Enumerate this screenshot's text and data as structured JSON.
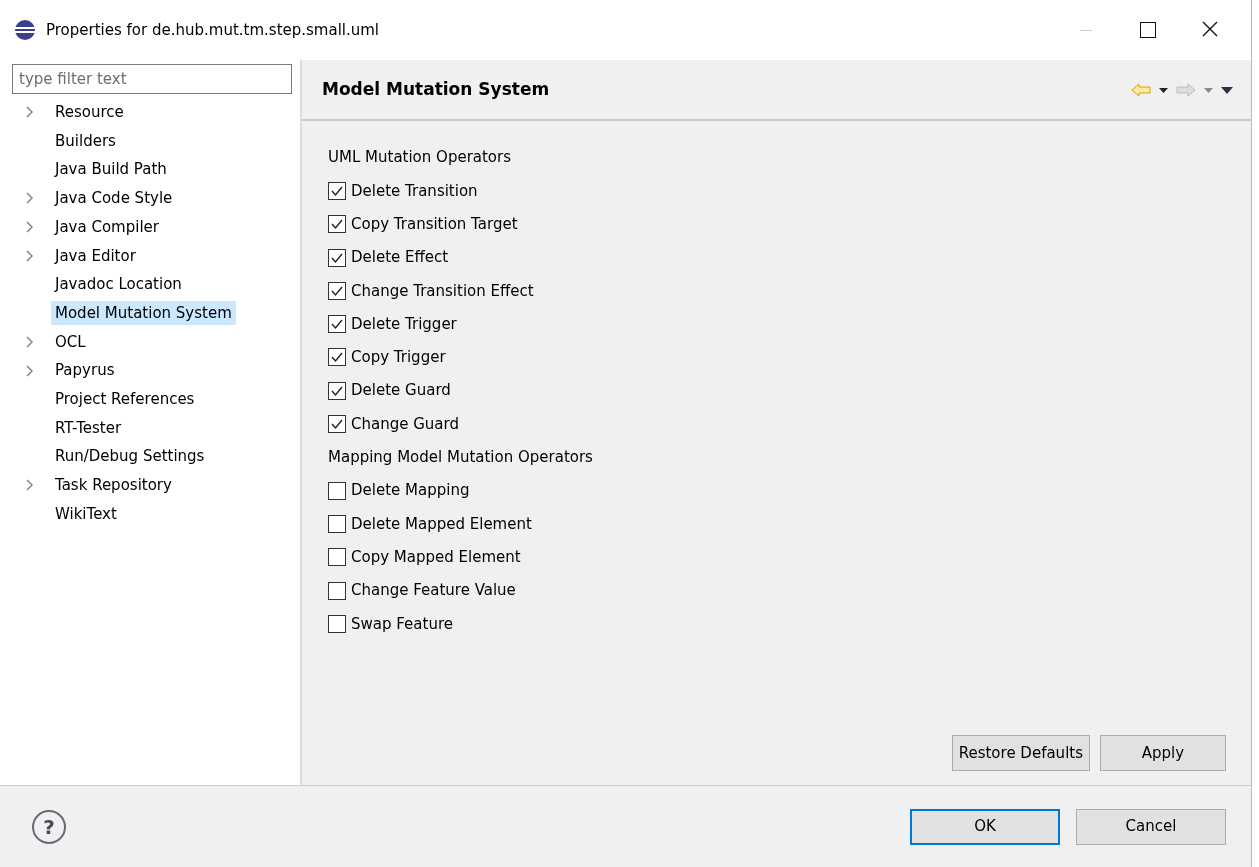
{
  "window": {
    "title": "Properties for de.hub.mut.tm.step.small.uml"
  },
  "filter": {
    "placeholder": "type filter text"
  },
  "tree": [
    {
      "label": "Resource",
      "expandable": true,
      "selected": false
    },
    {
      "label": "Builders",
      "expandable": false,
      "selected": false
    },
    {
      "label": "Java Build Path",
      "expandable": false,
      "selected": false
    },
    {
      "label": "Java Code Style",
      "expandable": true,
      "selected": false
    },
    {
      "label": "Java Compiler",
      "expandable": true,
      "selected": false
    },
    {
      "label": "Java Editor",
      "expandable": true,
      "selected": false
    },
    {
      "label": "Javadoc Location",
      "expandable": false,
      "selected": false
    },
    {
      "label": "Model Mutation System",
      "expandable": false,
      "selected": true
    },
    {
      "label": "OCL",
      "expandable": true,
      "selected": false
    },
    {
      "label": "Papyrus",
      "expandable": true,
      "selected": false
    },
    {
      "label": "Project References",
      "expandable": false,
      "selected": false
    },
    {
      "label": "RT-Tester",
      "expandable": false,
      "selected": false
    },
    {
      "label": "Run/Debug Settings",
      "expandable": false,
      "selected": false
    },
    {
      "label": "Task Repository",
      "expandable": true,
      "selected": false
    },
    {
      "label": "WikiText",
      "expandable": false,
      "selected": false
    }
  ],
  "page": {
    "title": "Model Mutation System",
    "forward_disabled": true
  },
  "sections": [
    {
      "heading": "UML Mutation Operators",
      "options": [
        {
          "label": "Delete Transition",
          "checked": true
        },
        {
          "label": "Copy Transition Target",
          "checked": true
        },
        {
          "label": "Delete Effect",
          "checked": true
        },
        {
          "label": "Change Transition Effect",
          "checked": true
        },
        {
          "label": "Delete Trigger",
          "checked": true
        },
        {
          "label": "Copy Trigger",
          "checked": true
        },
        {
          "label": "Delete Guard",
          "checked": true
        },
        {
          "label": "Change Guard",
          "checked": true
        }
      ]
    },
    {
      "heading": "Mapping Model Mutation Operators",
      "options": [
        {
          "label": "Delete Mapping",
          "checked": false
        },
        {
          "label": "Delete Mapped Element",
          "checked": false
        },
        {
          "label": "Copy Mapped Element",
          "checked": false
        },
        {
          "label": "Change Feature Value",
          "checked": false
        },
        {
          "label": "Swap Feature",
          "checked": false
        }
      ]
    }
  ],
  "page_buttons": [
    "Restore Defaults",
    "Apply"
  ],
  "help_button": {
    "label": "?"
  },
  "dialog_buttons": [
    {
      "label": "OK",
      "default": true
    },
    {
      "label": "Cancel",
      "default": false
    }
  ]
}
